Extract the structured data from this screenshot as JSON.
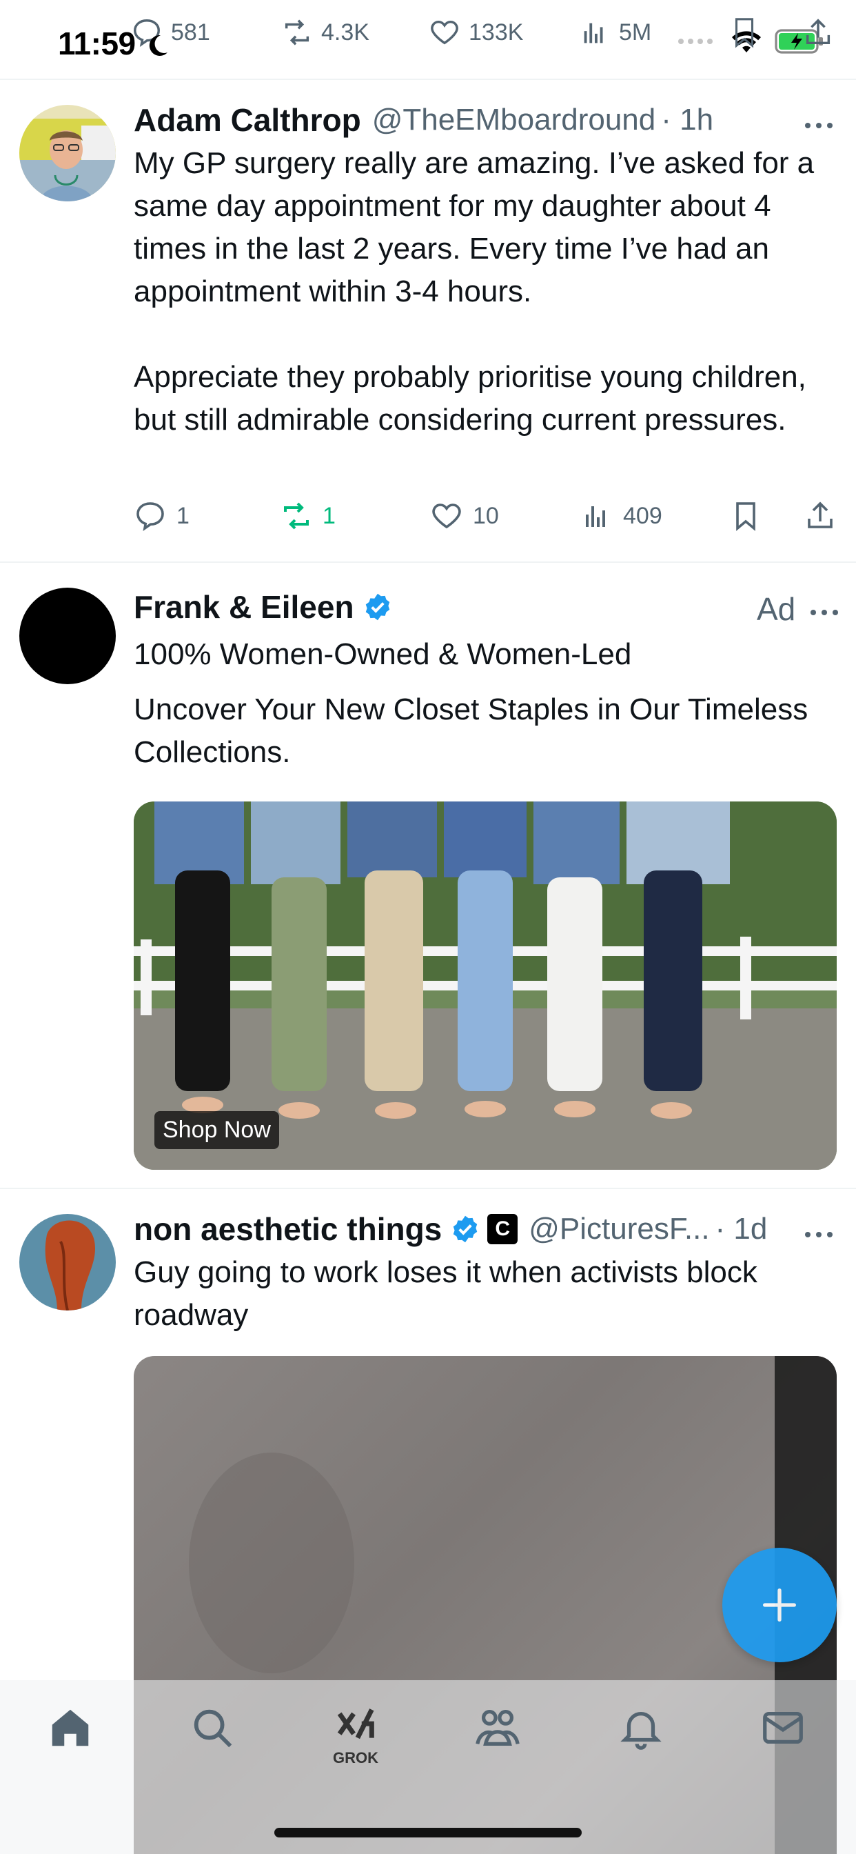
{
  "status_bar": {
    "time": "11:59",
    "top_stats": {
      "replies": "581",
      "reposts": "4.3K",
      "likes": "133K",
      "views": "5M"
    }
  },
  "tweets": [
    {
      "name": "Adam Calthrop",
      "handle": "@TheEMboardround",
      "time": "· 1h",
      "text": "My GP surgery really are amazing. I’ve asked for a same day appointment for my daughter about 4 times in the last 2 years. Every time I’ve had an appointment within 3-4 hours.\n\nAppreciate they probably prioritise young children, but still admirable considering current pressures.",
      "replies": "1",
      "reposts": "1",
      "likes": "10",
      "views": "409"
    },
    {
      "name": "Frank & Eileen",
      "ad_label": "Ad",
      "headline": "100% Women-Owned & Women-Led",
      "text": "Uncover Your New Closet Staples in Our Timeless Collections.",
      "cta": "Shop Now"
    },
    {
      "name": "non aesthetic things",
      "handle": "@PicturesF...",
      "time": "· 1d",
      "badge_letter": "C",
      "text": "Guy going to work loses it when activists block roadway"
    }
  ],
  "tab_bar": {
    "grok_label": "GROK"
  },
  "colors": {
    "accent": "#1d9bf0",
    "repost_active": "#00ba7c",
    "secondary_text": "#536471"
  }
}
